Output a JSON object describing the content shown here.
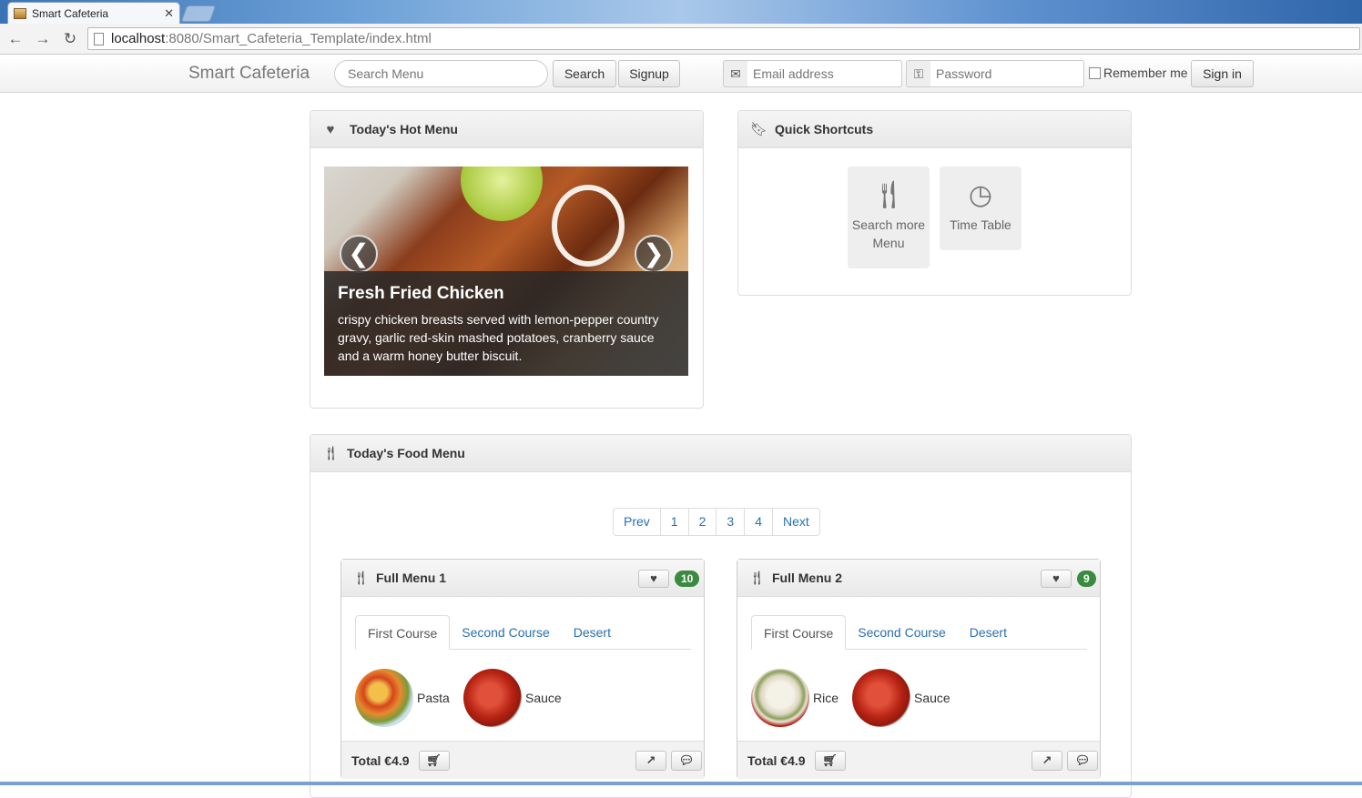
{
  "browser": {
    "tab_title": "Smart Cafeteria",
    "url_host": "localhost",
    "url_rest": ":8080/Smart_Cafeteria_Template/index.html"
  },
  "navbar": {
    "brand": "Smart Cafeteria",
    "search_placeholder": "Search Menu",
    "search_button": "Search",
    "signup_button": "Signup",
    "email_placeholder": "Email address",
    "password_placeholder": "Password",
    "remember_label": "Remember me",
    "signin_button": "Sign in"
  },
  "hot_menu": {
    "heading": "Today's Hot Menu",
    "slide_title": "Fresh Fried Chicken",
    "slide_text": "crispy chicken breasts served with lemon-pepper country gravy, garlic red-skin mashed potatoes, cranberry sauce and a warm honey butter biscuit.",
    "prev_glyph": "❮",
    "next_glyph": "❯"
  },
  "shortcuts": {
    "heading": "Quick Shortcuts",
    "items": [
      {
        "label": "Search more Menu",
        "icon": "cutlery-icon"
      },
      {
        "label": "Time Table",
        "icon": "clock-icon"
      }
    ]
  },
  "food_menu": {
    "heading": "Today's Food Menu",
    "pagination": [
      "Prev",
      "1",
      "2",
      "3",
      "4",
      "Next"
    ],
    "cards": [
      {
        "title": "Full Menu 1",
        "likes": "10",
        "tabs": [
          "First Course",
          "Second Course",
          "Desert"
        ],
        "items": [
          "Pasta",
          "Sauce"
        ],
        "total": "Total €4.9"
      },
      {
        "title": "Full Menu 2",
        "likes": "9",
        "tabs": [
          "First Course",
          "Second Course",
          "Desert"
        ],
        "items": [
          "Rice",
          "Sauce"
        ],
        "total": "Total €4.9"
      }
    ]
  },
  "colors": {
    "link": "#2a6fb0",
    "badge": "#3a8a3f"
  }
}
